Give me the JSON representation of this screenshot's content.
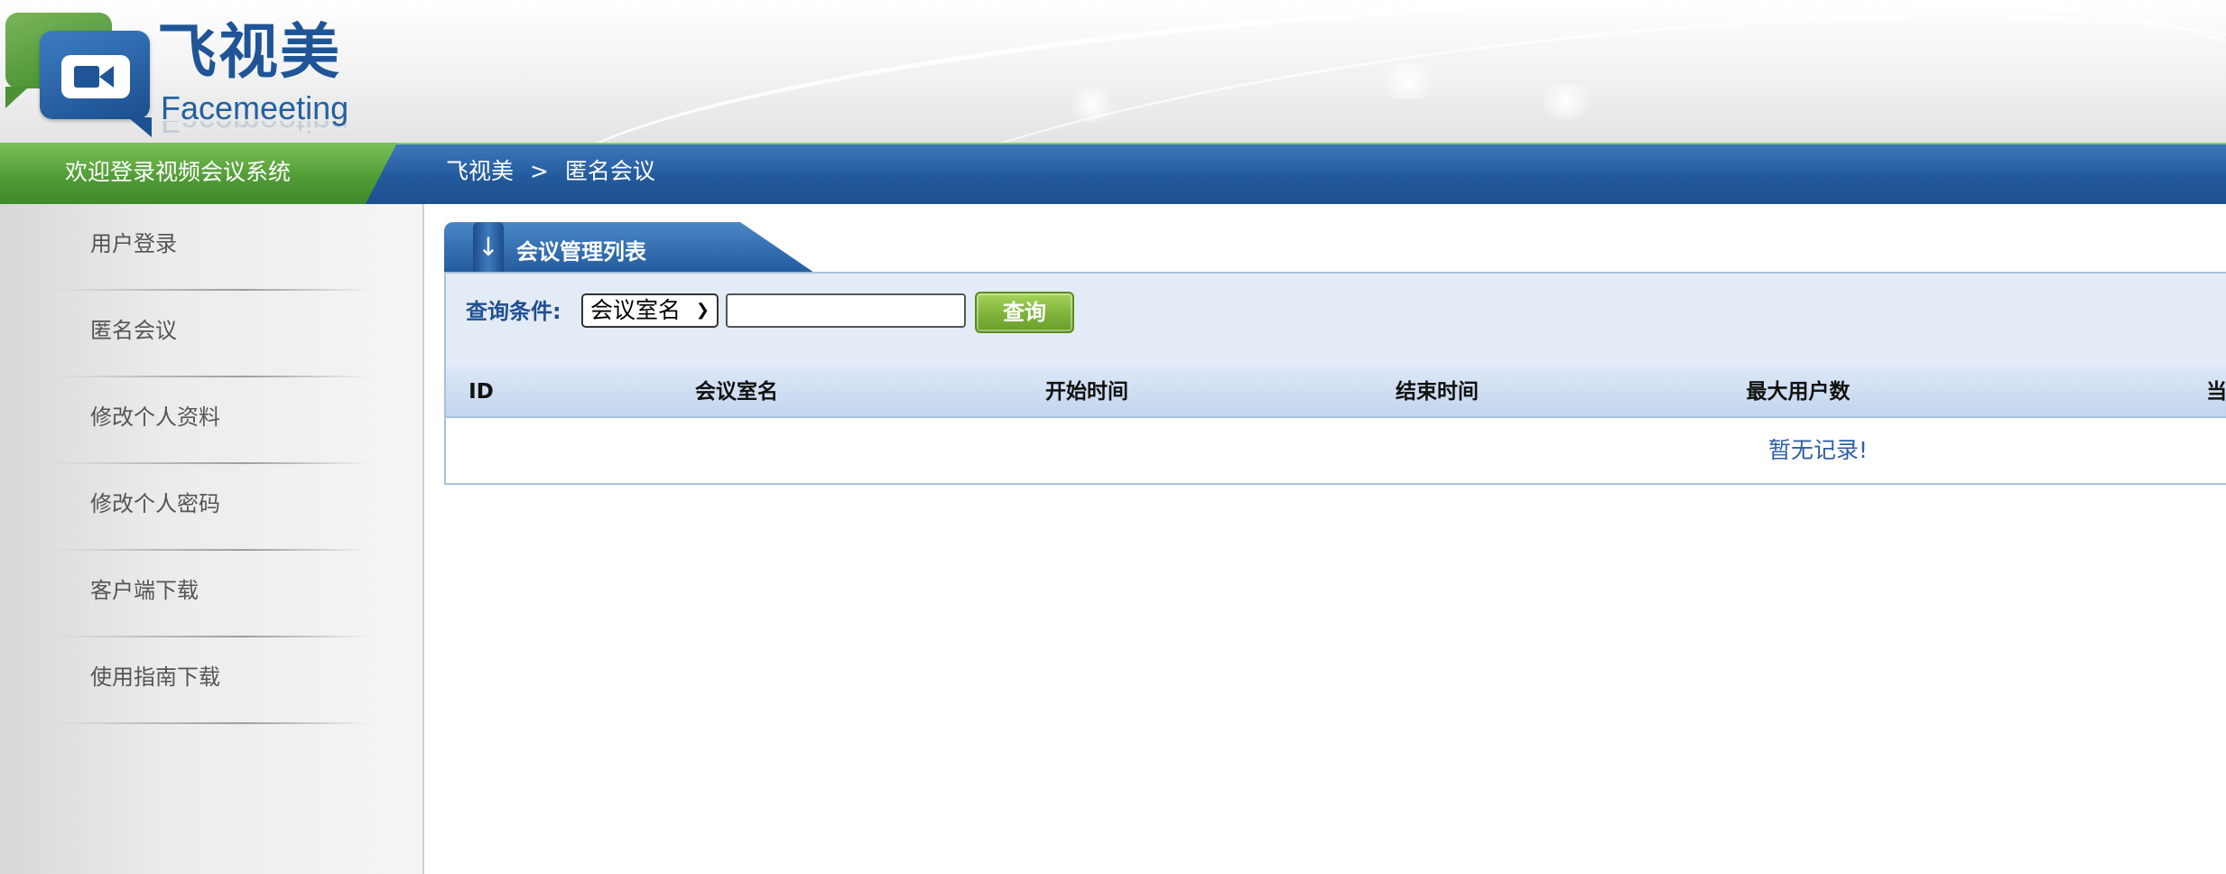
{
  "header": {
    "logo_cn": "飞视美",
    "logo_en": "Facemeeting"
  },
  "navbar": {
    "welcome": "欢迎登录视频会议系统",
    "breadcrumb": [
      "飞视美",
      ">",
      "匿名会议"
    ]
  },
  "sidebar": {
    "items": [
      {
        "label": "用户登录"
      },
      {
        "label": "匿名会议"
      },
      {
        "label": "修改个人资料"
      },
      {
        "label": "修改个人密码"
      },
      {
        "label": "客户端下载"
      },
      {
        "label": "使用指南下载"
      }
    ]
  },
  "panel": {
    "title": "会议管理列表",
    "tab_icon": "down-arrow-icon",
    "search": {
      "label": "查询条件:",
      "select_value": "会议室名",
      "input_value": "",
      "button_label": "查询"
    },
    "table": {
      "columns": [
        "ID",
        "会议室名",
        "开始时间",
        "结束时间",
        "最大用户数",
        "当"
      ],
      "empty_text": "暂无记录!"
    }
  },
  "colors": {
    "nav_blue": "#235a9c",
    "welcome_green": "#4f9a34",
    "button_green": "#7fb33a",
    "label_blue": "#1f4f8f"
  }
}
